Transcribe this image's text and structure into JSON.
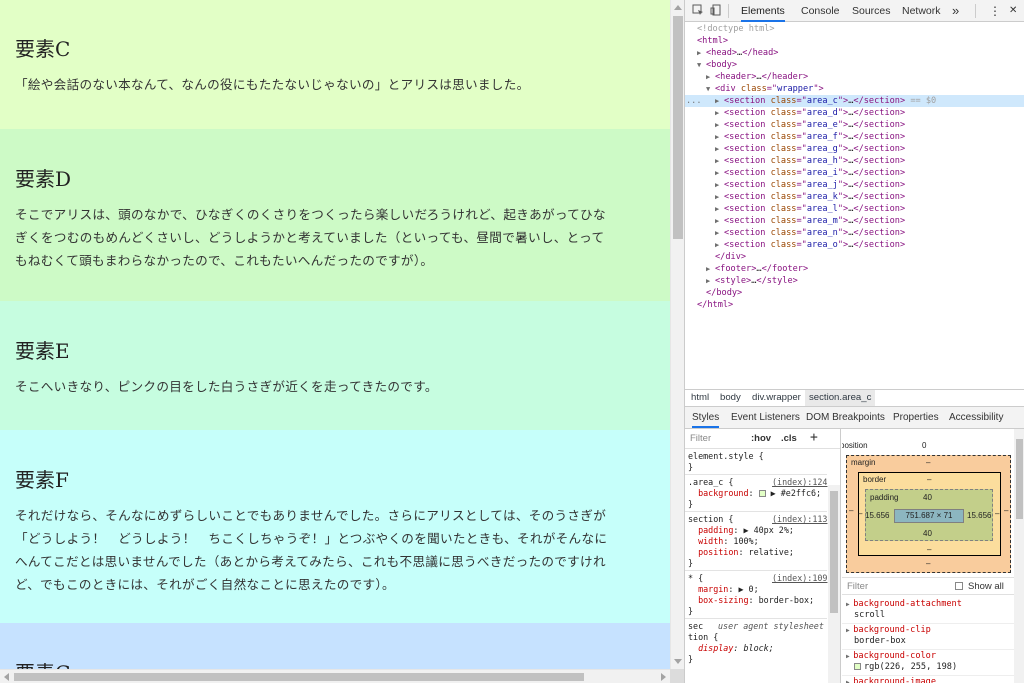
{
  "page": {
    "sections": [
      {
        "heading": "要素C",
        "lines": [
          "「絵や会話のない本なんて、なんの役にもたたないじゃないの」とアリスは思いました。"
        ],
        "bg": "#e2ffc6"
      },
      {
        "heading": "要素D",
        "lines": [
          "そこでアリスは、頭のなかで、ひなぎくのくさりをつくったら楽しいだろうけれど、起きあがってひな",
          "ぎくをつむのもめんどくさいし、どうしようかと考えていました（といっても、昼間で暑いし、とって",
          "もねむくて頭もまわらなかったので、これもたいへんだったのですが）。"
        ],
        "bg": "#cdfac6"
      },
      {
        "heading": "要素E",
        "lines": [
          "そこへいきなり、ピンクの目をした白うさぎが近くを走ってきたのです。"
        ],
        "bg": "#c6fde0"
      },
      {
        "heading": "要素F",
        "lines": [
          "それだけなら、そんなにめずらしいことでもありませんでした。さらにアリスとしては、そのうさぎが",
          "「どうしよう！　どうしよう！　ちこくしちゃうぞ！」とつぶやくのを聞いたときも、それがそんなに",
          "へんてこだとは思いませんでした（あとから考えてみたら、これも不思議に思うべきだったのですけれ",
          "ど、でもこのときには、それがごく自然なことに思えたのです）。"
        ],
        "bg": "#c6fffa"
      },
      {
        "heading": "要素G",
        "lines": [],
        "bg": "#c6e2ff"
      }
    ]
  },
  "devtools": {
    "tabs": [
      "Elements",
      "Console",
      "Sources",
      "Network"
    ],
    "more": "»",
    "menu": "⋮",
    "close": "✕",
    "dom": [
      {
        "indent": 0,
        "tw": "",
        "segs": [
          [
            "c-gray",
            "<!doctype html>"
          ]
        ]
      },
      {
        "indent": 0,
        "tw": "",
        "segs": [
          [
            "c-tag",
            "<html>"
          ]
        ]
      },
      {
        "indent": 1,
        "tw": "▶",
        "segs": [
          [
            "c-tag",
            "<head>"
          ],
          [
            "c-txt",
            "…"
          ],
          [
            "c-tag",
            "</head>"
          ]
        ]
      },
      {
        "indent": 1,
        "tw": "▼",
        "segs": [
          [
            "c-tag",
            "<body>"
          ]
        ]
      },
      {
        "indent": 2,
        "tw": "▶",
        "segs": [
          [
            "c-tag",
            "<header>"
          ],
          [
            "c-txt",
            "…"
          ],
          [
            "c-tag",
            "</header>"
          ]
        ]
      },
      {
        "indent": 2,
        "tw": "▼",
        "segs": [
          [
            "c-tag",
            "<div "
          ],
          [
            "c-att",
            "class"
          ],
          [
            "c-tag",
            "=\""
          ],
          [
            "c-val",
            "wrapper"
          ],
          [
            "c-tag",
            "\">"
          ]
        ]
      },
      {
        "indent": 3,
        "tw": "▶",
        "sel": true,
        "segs": [
          [
            "c-tag",
            "<section "
          ],
          [
            "c-att",
            "class"
          ],
          [
            "c-tag",
            "=\""
          ],
          [
            "c-val",
            "area_c"
          ],
          [
            "c-tag",
            "\">"
          ],
          [
            "c-txt",
            "…"
          ],
          [
            "c-tag",
            "</section>"
          ],
          [
            "c-gray",
            " == $0"
          ]
        ]
      },
      {
        "indent": 3,
        "tw": "▶",
        "segs": [
          [
            "c-tag",
            "<section "
          ],
          [
            "c-att",
            "class"
          ],
          [
            "c-tag",
            "=\""
          ],
          [
            "c-val",
            "area_d"
          ],
          [
            "c-tag",
            "\">"
          ],
          [
            "c-txt",
            "…"
          ],
          [
            "c-tag",
            "</section>"
          ]
        ]
      },
      {
        "indent": 3,
        "tw": "▶",
        "segs": [
          [
            "c-tag",
            "<section "
          ],
          [
            "c-att",
            "class"
          ],
          [
            "c-tag",
            "=\""
          ],
          [
            "c-val",
            "area_e"
          ],
          [
            "c-tag",
            "\">"
          ],
          [
            "c-txt",
            "…"
          ],
          [
            "c-tag",
            "</section>"
          ]
        ]
      },
      {
        "indent": 3,
        "tw": "▶",
        "segs": [
          [
            "c-tag",
            "<section "
          ],
          [
            "c-att",
            "class"
          ],
          [
            "c-tag",
            "=\""
          ],
          [
            "c-val",
            "area_f"
          ],
          [
            "c-tag",
            "\">"
          ],
          [
            "c-txt",
            "…"
          ],
          [
            "c-tag",
            "</section>"
          ]
        ]
      },
      {
        "indent": 3,
        "tw": "▶",
        "segs": [
          [
            "c-tag",
            "<section "
          ],
          [
            "c-att",
            "class"
          ],
          [
            "c-tag",
            "=\""
          ],
          [
            "c-val",
            "area_g"
          ],
          [
            "c-tag",
            "\">"
          ],
          [
            "c-txt",
            "…"
          ],
          [
            "c-tag",
            "</section>"
          ]
        ]
      },
      {
        "indent": 3,
        "tw": "▶",
        "segs": [
          [
            "c-tag",
            "<section "
          ],
          [
            "c-att",
            "class"
          ],
          [
            "c-tag",
            "=\""
          ],
          [
            "c-val",
            "area_h"
          ],
          [
            "c-tag",
            "\">"
          ],
          [
            "c-txt",
            "…"
          ],
          [
            "c-tag",
            "</section>"
          ]
        ]
      },
      {
        "indent": 3,
        "tw": "▶",
        "segs": [
          [
            "c-tag",
            "<section "
          ],
          [
            "c-att",
            "class"
          ],
          [
            "c-tag",
            "=\""
          ],
          [
            "c-val",
            "area_i"
          ],
          [
            "c-tag",
            "\">"
          ],
          [
            "c-txt",
            "…"
          ],
          [
            "c-tag",
            "</section>"
          ]
        ]
      },
      {
        "indent": 3,
        "tw": "▶",
        "segs": [
          [
            "c-tag",
            "<section "
          ],
          [
            "c-att",
            "class"
          ],
          [
            "c-tag",
            "=\""
          ],
          [
            "c-val",
            "area_j"
          ],
          [
            "c-tag",
            "\">"
          ],
          [
            "c-txt",
            "…"
          ],
          [
            "c-tag",
            "</section>"
          ]
        ]
      },
      {
        "indent": 3,
        "tw": "▶",
        "segs": [
          [
            "c-tag",
            "<section "
          ],
          [
            "c-att",
            "class"
          ],
          [
            "c-tag",
            "=\""
          ],
          [
            "c-val",
            "area_k"
          ],
          [
            "c-tag",
            "\">"
          ],
          [
            "c-txt",
            "…"
          ],
          [
            "c-tag",
            "</section>"
          ]
        ]
      },
      {
        "indent": 3,
        "tw": "▶",
        "segs": [
          [
            "c-tag",
            "<section "
          ],
          [
            "c-att",
            "class"
          ],
          [
            "c-tag",
            "=\""
          ],
          [
            "c-val",
            "area_l"
          ],
          [
            "c-tag",
            "\">"
          ],
          [
            "c-txt",
            "…"
          ],
          [
            "c-tag",
            "</section>"
          ]
        ]
      },
      {
        "indent": 3,
        "tw": "▶",
        "segs": [
          [
            "c-tag",
            "<section "
          ],
          [
            "c-att",
            "class"
          ],
          [
            "c-tag",
            "=\""
          ],
          [
            "c-val",
            "area_m"
          ],
          [
            "c-tag",
            "\">"
          ],
          [
            "c-txt",
            "…"
          ],
          [
            "c-tag",
            "</section>"
          ]
        ]
      },
      {
        "indent": 3,
        "tw": "▶",
        "segs": [
          [
            "c-tag",
            "<section "
          ],
          [
            "c-att",
            "class"
          ],
          [
            "c-tag",
            "=\""
          ],
          [
            "c-val",
            "area_n"
          ],
          [
            "c-tag",
            "\">"
          ],
          [
            "c-txt",
            "…"
          ],
          [
            "c-tag",
            "</section>"
          ]
        ]
      },
      {
        "indent": 3,
        "tw": "▶",
        "segs": [
          [
            "c-tag",
            "<section "
          ],
          [
            "c-att",
            "class"
          ],
          [
            "c-tag",
            "=\""
          ],
          [
            "c-val",
            "area_o"
          ],
          [
            "c-tag",
            "\">"
          ],
          [
            "c-txt",
            "…"
          ],
          [
            "c-tag",
            "</section>"
          ]
        ]
      },
      {
        "indent": 2,
        "tw": "",
        "segs": [
          [
            "c-tag",
            "</div>"
          ]
        ]
      },
      {
        "indent": 2,
        "tw": "▶",
        "segs": [
          [
            "c-tag",
            "<footer>"
          ],
          [
            "c-txt",
            "…"
          ],
          [
            "c-tag",
            "</footer>"
          ]
        ]
      },
      {
        "indent": 2,
        "tw": "▶",
        "segs": [
          [
            "c-tag",
            "<style>"
          ],
          [
            "c-txt",
            "…"
          ],
          [
            "c-tag",
            "</style>"
          ]
        ]
      },
      {
        "indent": 1,
        "tw": "",
        "segs": [
          [
            "c-tag",
            "</body>"
          ]
        ]
      },
      {
        "indent": 0,
        "tw": "",
        "segs": [
          [
            "c-tag",
            "</html>"
          ]
        ]
      }
    ],
    "dom_dots": "...",
    "breadcrumbs": [
      "html",
      "body",
      "div.wrapper",
      "section.area_c"
    ],
    "panel_tabs": [
      "Styles",
      "Event Listeners",
      "DOM Breakpoints",
      "Properties",
      "Accessibility"
    ],
    "styles": {
      "filter_placeholder": "Filter",
      "hov": ":hov",
      "cls": ".cls",
      "plus": "+",
      "element_style": "element.style {",
      "rules": [
        {
          "selector": ".area_c {",
          "link": "(index):124",
          "decls": [
            [
              "background",
              "▶ #e2ffc6;"
            ]
          ],
          "swatch": "#e2ffc6"
        },
        {
          "selector": "section {",
          "link": "(index):113",
          "decls": [
            [
              "padding",
              "▶ 40px 2%;"
            ],
            [
              "width",
              "100%;"
            ],
            [
              "position",
              "relative;"
            ]
          ]
        },
        {
          "selector": "* {",
          "link": "(index):109",
          "decls": [
            [
              "margin",
              "▶ 0;"
            ],
            [
              "box-sizing",
              "border-box;"
            ]
          ]
        }
      ],
      "ua_selector_1": "sec",
      "ua_selector_2": "tion {",
      "ua_label": "user agent stylesheet",
      "ua_decl": [
        "display",
        "block;"
      ]
    },
    "computed": {
      "position_label": "position",
      "position_value": "0",
      "margin_label": "margin",
      "margin_top": "–",
      "margin_bottom": "–",
      "margin_left": "–",
      "margin_right": "–",
      "border_label": "border",
      "border_top": "–",
      "border_bottom": "–",
      "border_left": "–",
      "border_right": "–",
      "padding_label": "padding",
      "padding_top": "40",
      "padding_bottom": "40",
      "padding_left": "15.656",
      "padding_right": "15.656",
      "content": "751.687 × 71",
      "filter_placeholder": "Filter",
      "show_all": "Show all",
      "props": [
        {
          "name": "background-attachment",
          "value": "scroll"
        },
        {
          "name": "background-clip",
          "value": "border-box"
        },
        {
          "name": "background-color",
          "value": "rgb(226, 255, 198)",
          "swatch": "#e2ffc6"
        },
        {
          "name": "background-image",
          "value": ""
        }
      ]
    }
  }
}
